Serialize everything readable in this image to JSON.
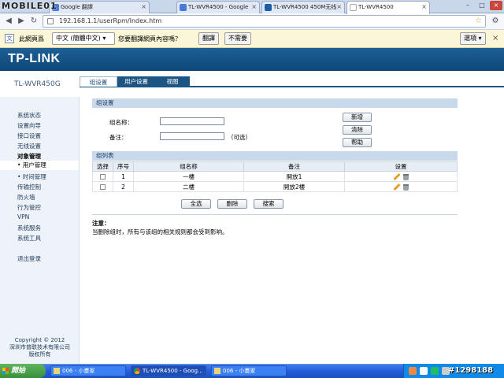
{
  "browser": {
    "brand_logo": "MOBILE01",
    "tabs": [
      {
        "title": "Google 翻譯",
        "favicon_color": "#4a7ad8"
      },
      {
        "title": "TL-WVR4500 - Google",
        "favicon_color": "#4a7ad8"
      },
      {
        "title": "TL-WVR4500 450M无线",
        "favicon_color": "#1a5ea8"
      },
      {
        "title": "TL-WVR4500",
        "favicon_color": "#ffffff"
      }
    ],
    "tab_close": "×",
    "address": "192.168.1.1/userRpm/Index.htm",
    "window_controls": {
      "minimize": "–",
      "maximize": "□",
      "close": "×"
    }
  },
  "translate_bar": {
    "prompt": "此網頁爲",
    "language": "中文 (簡體中文)",
    "question": "您要翻譯網頁內容嗎？",
    "translate_button": "翻譯",
    "decline_button": "不需要",
    "options_button": "選項",
    "close": "×"
  },
  "router": {
    "logo": "TP-LINK",
    "model": "TL-WVR450G",
    "nav_tabs": [
      "组设置",
      "用户设置",
      "视图"
    ],
    "active_tab": 0,
    "sidebar": [
      {
        "label": "系统状态",
        "style": "normal"
      },
      {
        "label": "设置向导",
        "style": "normal"
      },
      {
        "label": "接口设置",
        "style": "normal"
      },
      {
        "label": "无线设置",
        "style": "normal"
      },
      {
        "label": "对象管理",
        "style": "bold"
      },
      {
        "label": "• 用户管理",
        "style": "active"
      },
      {
        "label": "• 时间管理",
        "style": "sub"
      },
      {
        "label": "传输控制",
        "style": "normal"
      },
      {
        "label": "防火墙",
        "style": "normal"
      },
      {
        "label": "行为管控",
        "style": "normal"
      },
      {
        "label": "VPN",
        "style": "normal"
      },
      {
        "label": "系统服务",
        "style": "normal"
      },
      {
        "label": "系统工具",
        "style": "normal"
      },
      {
        "label": "退出登录",
        "style": "normal"
      }
    ],
    "copyright": [
      "Copyright © 2012",
      "深圳市普联技术有限公司",
      "版权所有"
    ],
    "group_settings": {
      "header": "组设置",
      "name_label": "组名称：",
      "note_label": "备注：",
      "optional": "（可选）",
      "name_value": "",
      "note_value": "",
      "buttons": {
        "add": "新增",
        "clear": "清除",
        "help": "帮助"
      }
    },
    "group_list": {
      "header": "组列表",
      "columns": [
        "选择",
        "序号",
        "组名称",
        "备注",
        "设置"
      ],
      "rows": [
        {
          "index": "1",
          "name": "一樓",
          "note": "開放1"
        },
        {
          "index": "2",
          "name": "二樓",
          "note": "開放2樓"
        }
      ],
      "buttons": {
        "select_all": "全选",
        "delete": "删除",
        "search": "搜索"
      }
    },
    "note": {
      "title": "注意：",
      "text": "当删除组时，所有与该组的相关规则都会受到影响。"
    }
  },
  "taskbar": {
    "start": "開始",
    "tasks": [
      {
        "title": "006 - 小畫家"
      },
      {
        "title": "TL-WVR4500 - Goog..."
      },
      {
        "title": "006 - 小畫家"
      }
    ],
    "watermark": "#1298188"
  }
}
